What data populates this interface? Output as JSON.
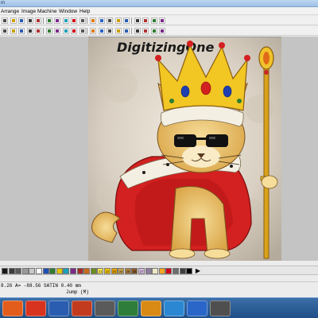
{
  "window": {
    "title_fragment": "m"
  },
  "menu": {
    "items": [
      "Arrange",
      "Image",
      "Machine",
      "Window",
      "Help"
    ]
  },
  "toolbar1": {
    "icons": [
      "new-icon",
      "open-icon",
      "save-icon",
      "print-icon",
      "cut-icon",
      "copy-icon",
      "paste-icon",
      "undo-icon",
      "redo-icon",
      "zoom-icon",
      "zoom-in-icon",
      "zoom-out-icon",
      "pan-icon",
      "grid-icon",
      "select-icon",
      "pen-icon",
      "shape-icon",
      "fill-icon",
      "text-icon"
    ]
  },
  "toolbar2": {
    "icons": [
      "stitch-icon",
      "satin-icon",
      "fill-stitch-icon",
      "run-icon",
      "jump-icon",
      "trim-icon",
      "color-change-icon",
      "node-icon",
      "align-icon",
      "mirror-icon",
      "rotate-icon",
      "scale-icon",
      "group-icon",
      "ungroup-icon",
      "lock-icon",
      "hide-icon",
      "layers-icon",
      "view-3d-icon",
      "simulate-icon"
    ]
  },
  "design": {
    "watermark": "DigitizingOne"
  },
  "palette": {
    "swatches": [
      {
        "n": "",
        "c": "#1a1a1a"
      },
      {
        "n": "",
        "c": "#3b3b3b"
      },
      {
        "n": "",
        "c": "#5a5a5a"
      },
      {
        "n": "",
        "c": "#9a9a9a"
      },
      {
        "n": "",
        "c": "#c8c8c8"
      },
      {
        "n": "",
        "c": "#ffffff"
      },
      {
        "n": "",
        "c": "#1f4fb5"
      },
      {
        "n": "",
        "c": "#2e7d32"
      },
      {
        "n": "",
        "c": "#e0c400"
      },
      {
        "n": "",
        "c": "#1aa0b8"
      },
      {
        "n": "",
        "c": "#7b2a8a"
      },
      {
        "n": "",
        "c": "#a52a2a"
      },
      {
        "n": "",
        "c": "#c96a1a"
      },
      {
        "n": "",
        "c": "#6b8e23"
      },
      {
        "n": "21",
        "c": "#f5e64a"
      },
      {
        "n": "22",
        "c": "#f2c400"
      },
      {
        "n": "23",
        "c": "#e8a100"
      },
      {
        "n": "24",
        "c": "#c8a24a"
      },
      {
        "n": "25",
        "c": "#b08040"
      },
      {
        "n": "26",
        "c": "#8c5a2a"
      },
      {
        "n": "27",
        "c": "#d4b8e0"
      },
      {
        "n": "",
        "c": "#8e7c9e"
      },
      {
        "n": "",
        "c": "#f1e9c6"
      },
      {
        "n": "",
        "c": "#f5a623"
      },
      {
        "n": "",
        "c": "#d0021b"
      },
      {
        "n": "",
        "c": "#6d6d6d"
      },
      {
        "n": "",
        "c": "#3f3f3f"
      },
      {
        "n": "",
        "c": "#000000"
      }
    ],
    "arrow": "▶"
  },
  "status": {
    "line1": "8.26 A= -88.56 SATIN   0.40 mm",
    "line2": "Jump (M)"
  },
  "taskbar": {
    "apps": [
      {
        "name": "app-1-icon",
        "label": "",
        "color": "#e25d1b"
      },
      {
        "name": "app-2-icon",
        "label": "",
        "color": "#d8331e"
      },
      {
        "name": "app-3-icon",
        "label": "",
        "color": "#2a5db0"
      },
      {
        "name": "app-4-icon",
        "label": "",
        "color": "#c23b1e"
      },
      {
        "name": "app-5-icon",
        "label": "",
        "color": "#5a5a5a"
      },
      {
        "name": "app-6-icon",
        "label": "",
        "color": "#2f7d3a"
      },
      {
        "name": "app-7-icon",
        "label": "",
        "color": "#d98a14"
      },
      {
        "name": "app-8-icon",
        "label": "",
        "color": "#2b87d1"
      },
      {
        "name": "app-9-icon",
        "label": "",
        "color": "#2a66c8"
      },
      {
        "name": "app-10-icon",
        "label": "",
        "color": "#4f4f4f"
      }
    ]
  }
}
